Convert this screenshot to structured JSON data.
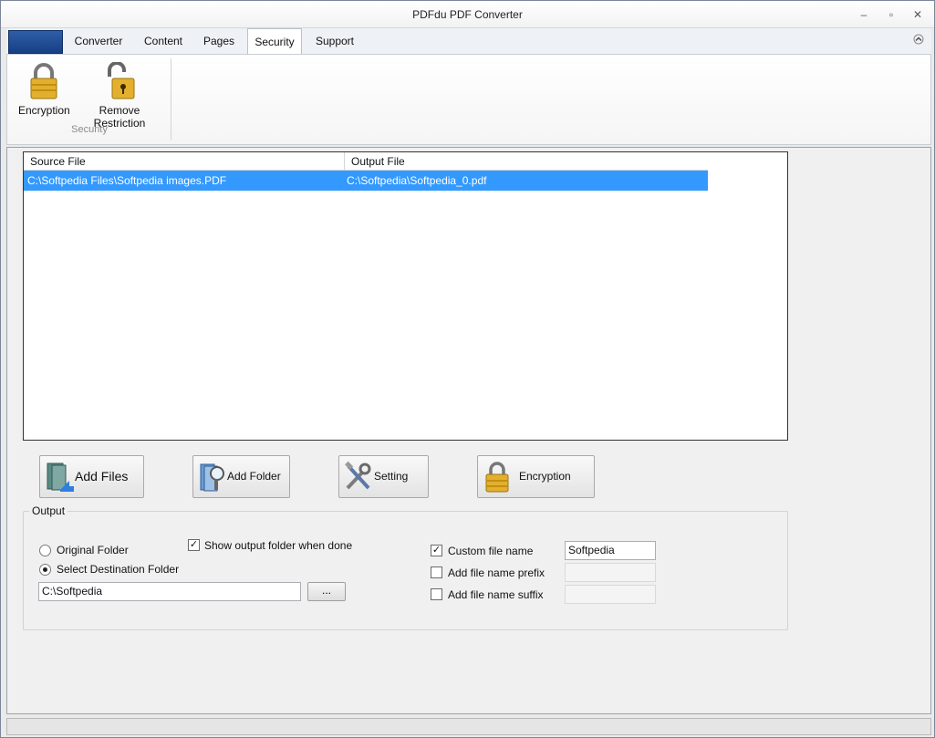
{
  "window": {
    "title": "PDFdu PDF Converter",
    "controls": {
      "minimize": "–",
      "maximize": "▫",
      "close": "✕"
    }
  },
  "tabs": [
    {
      "label": "Converter",
      "active": false
    },
    {
      "label": "Content",
      "active": false
    },
    {
      "label": "Pages",
      "active": false
    },
    {
      "label": "Security",
      "active": true
    },
    {
      "label": "Support",
      "active": false
    }
  ],
  "ribbon": {
    "collapse_icon": "chevron-up-icon",
    "group_label": "Security",
    "items": [
      {
        "label": "Encryption",
        "icon": "lock-closed-icon"
      },
      {
        "label": "Remove Restriction",
        "icon": "lock-open-icon"
      }
    ]
  },
  "file_list": {
    "columns": [
      "Source File",
      "Output File"
    ],
    "rows": [
      {
        "source": "C:\\Softpedia Files\\Softpedia images.PDF",
        "output": "C:\\Softpedia\\Softpedia_0.pdf",
        "selected": true
      }
    ]
  },
  "actions": {
    "add_files": "Add Files",
    "add_folder": "Add Folder",
    "setting": "Setting",
    "encryption": "Encryption"
  },
  "output": {
    "legend": "Output",
    "original_folder": "Original Folder",
    "select_destination": "Select Destination Folder",
    "destination_selected": true,
    "show_output_folder": "Show output folder when done",
    "show_output_checked": true,
    "destination_path": "C:\\Softpedia",
    "browse_label": "...",
    "custom_file_name": "Custom file name",
    "custom_checked": true,
    "custom_value": "Softpedia",
    "prefix_label": "Add file name prefix",
    "prefix_checked": false,
    "suffix_label": "Add file name suffix",
    "suffix_checked": false
  },
  "colors": {
    "selection": "#3399ff",
    "app_button": "#1f4a93",
    "lock_gold": "#d9a520"
  }
}
